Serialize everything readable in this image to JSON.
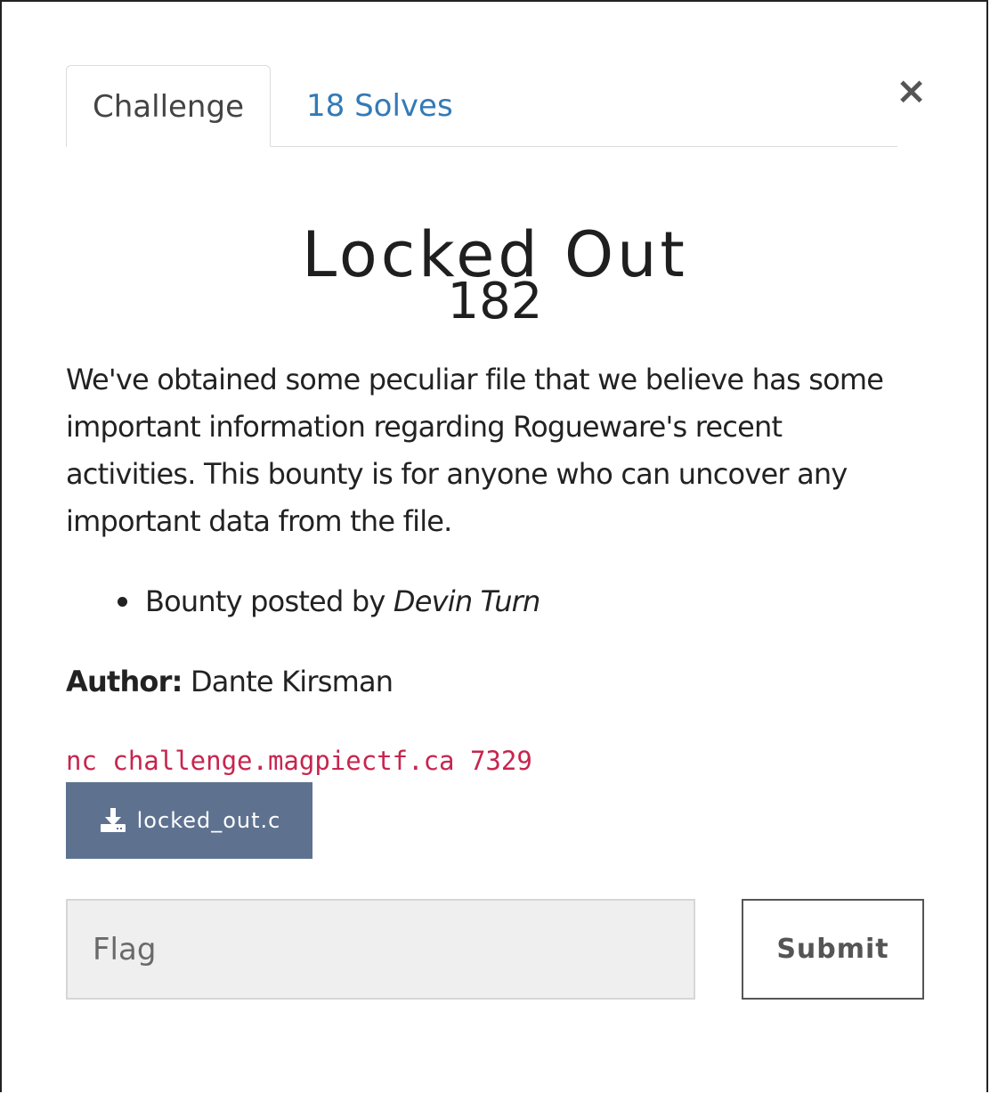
{
  "tabs": {
    "challenge": "Challenge",
    "solves": "18 Solves"
  },
  "close_icon": "×",
  "challenge": {
    "name": "Locked Out",
    "value": "182",
    "description": "We've obtained some peculiar file that we believe has some important information regarding Rogueware's recent activities. This bounty is for anyone who can uncover any important data from the file.",
    "bounty_prefix": "Bounty posted by",
    "bounty_author": "Devin Turn",
    "author_label": "Author:",
    "author_name": "Dante Kirsman",
    "connection": "nc challenge.magpiectf.ca 7329",
    "file": {
      "icon": "download-icon",
      "name": "locked_out.c"
    }
  },
  "form": {
    "flag_placeholder": "Flag",
    "flag_value": "",
    "submit_label": "Submit"
  },
  "colors": {
    "link": "#337ab7",
    "code": "#c7254e",
    "download_button": "#5e7290"
  }
}
